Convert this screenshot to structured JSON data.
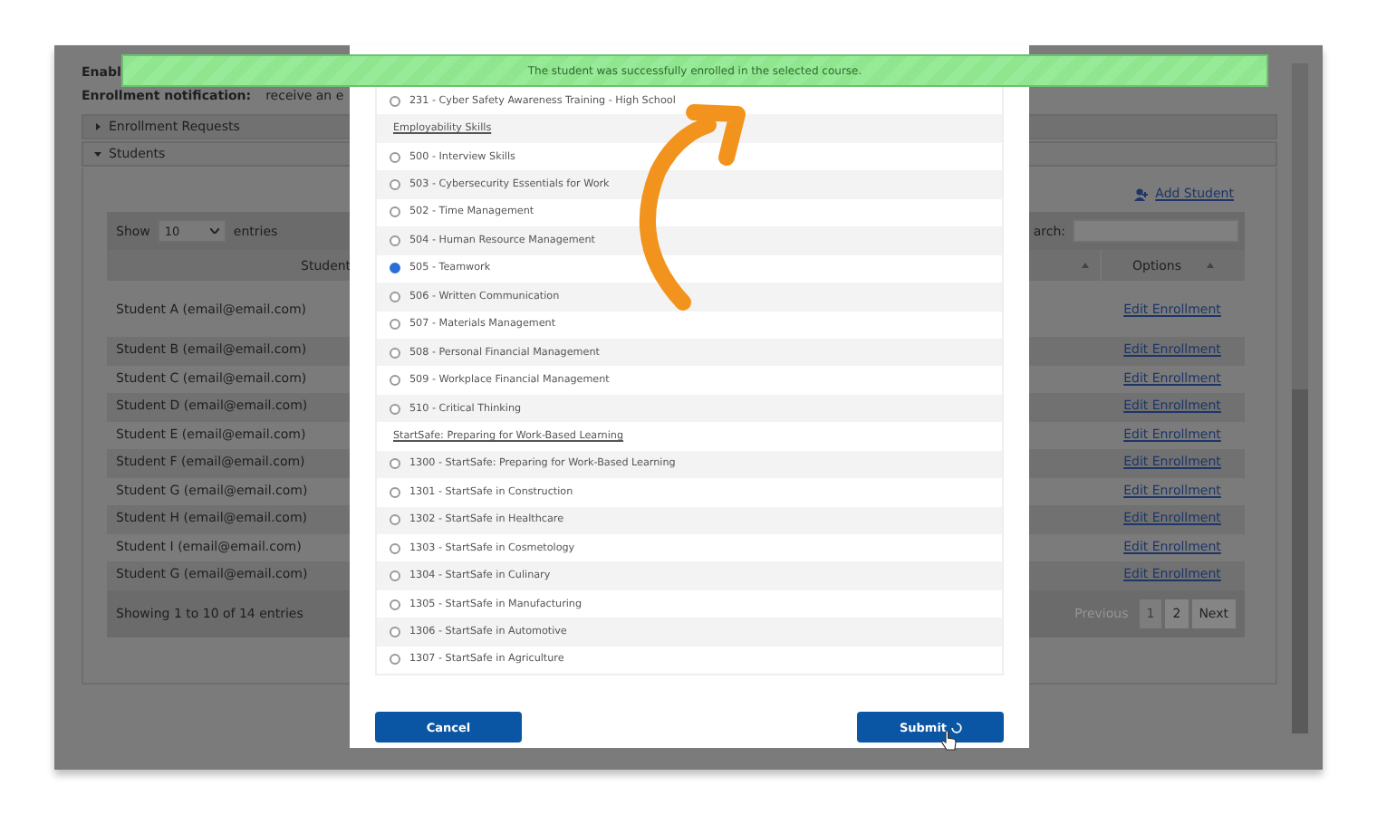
{
  "page": {
    "heading": "Enabl",
    "notification_label": "Enrollment notification:",
    "notification_value": "receive an e"
  },
  "accordion": [
    {
      "label": "Enrollment Requests",
      "expanded": false
    },
    {
      "label": "Students",
      "expanded": true
    }
  ],
  "add_student": "Add Student",
  "table": {
    "show_label": "Show",
    "length": "10",
    "entries_label": "entries",
    "search_label": "arch:",
    "columns": [
      "Student",
      "Options"
    ],
    "rows": [
      {
        "student": "Student A (email@email.com)",
        "action": "Edit Enrollment"
      },
      {
        "student": "Student B (email@email.com)",
        "action": "Edit Enrollment"
      },
      {
        "student": "Student C (email@email.com)",
        "action": "Edit Enrollment"
      },
      {
        "student": "Student D (email@email.com)",
        "action": "Edit Enrollment"
      },
      {
        "student": "Student E (email@email.com)",
        "action": "Edit Enrollment"
      },
      {
        "student": "Student F (email@email.com)",
        "action": "Edit Enrollment"
      },
      {
        "student": "Student G (email@email.com)",
        "action": "Edit Enrollment"
      },
      {
        "student": "Student H (email@email.com)",
        "action": "Edit Enrollment"
      },
      {
        "student": "Student I (email@email.com)",
        "action": "Edit Enrollment"
      },
      {
        "student": "Student G (email@email.com)",
        "action": "Edit Enrollment"
      }
    ],
    "info": "Showing 1 to 10 of 14 entries",
    "pagination": [
      {
        "label": "Previous",
        "selected": false,
        "disabled": true
      },
      {
        "label": "1",
        "selected": true,
        "disabled": false
      },
      {
        "label": "2",
        "selected": false,
        "disabled": false
      },
      {
        "label": "Next",
        "selected": false,
        "disabled": false
      }
    ]
  },
  "modal": {
    "courses": [
      {
        "kind": "option",
        "label": "231 - Cyber Safety Awareness Training - High School",
        "selected": false
      },
      {
        "kind": "heading",
        "label": "Employability Skills"
      },
      {
        "kind": "option",
        "label": "500 - Interview Skills",
        "selected": false
      },
      {
        "kind": "option",
        "label": "503 - Cybersecurity Essentials for Work",
        "selected": false
      },
      {
        "kind": "option",
        "label": "502 - Time Management",
        "selected": false
      },
      {
        "kind": "option",
        "label": "504 - Human Resource Management",
        "selected": false
      },
      {
        "kind": "option",
        "label": "505 - Teamwork",
        "selected": true
      },
      {
        "kind": "option",
        "label": "506 - Written Communication",
        "selected": false
      },
      {
        "kind": "option",
        "label": "507 - Materials Management",
        "selected": false
      },
      {
        "kind": "option",
        "label": "508 - Personal Financial Management",
        "selected": false
      },
      {
        "kind": "option",
        "label": "509 - Workplace Financial Management",
        "selected": false
      },
      {
        "kind": "option",
        "label": "510 - Critical Thinking",
        "selected": false
      },
      {
        "kind": "heading",
        "label": "StartSafe: Preparing for Work-Based Learning"
      },
      {
        "kind": "option",
        "label": "1300 - StartSafe: Preparing for Work-Based Learning",
        "selected": false
      },
      {
        "kind": "option",
        "label": "1301 - StartSafe in Construction",
        "selected": false
      },
      {
        "kind": "option",
        "label": "1302 - StartSafe in Healthcare",
        "selected": false
      },
      {
        "kind": "option",
        "label": "1303 - StartSafe in Cosmetology",
        "selected": false
      },
      {
        "kind": "option",
        "label": "1304 - StartSafe in Culinary",
        "selected": false
      },
      {
        "kind": "option",
        "label": "1305 - StartSafe in Manufacturing",
        "selected": false
      },
      {
        "kind": "option",
        "label": "1306 - StartSafe in Automotive",
        "selected": false
      },
      {
        "kind": "option",
        "label": "1307 - StartSafe in Agriculture",
        "selected": false
      }
    ],
    "buttons": [
      {
        "label": "Cancel",
        "loading": false
      },
      {
        "label": "Submit",
        "loading": true
      }
    ]
  },
  "toast": "The student was successfully enrolled in the selected course."
}
